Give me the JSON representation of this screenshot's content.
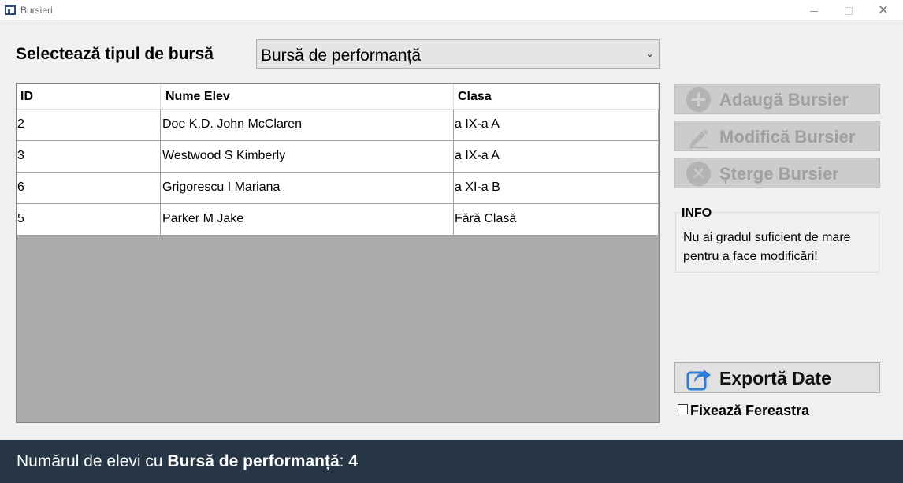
{
  "window": {
    "title": "Bursieri"
  },
  "selector": {
    "label": "Selectează tipul de bursă",
    "selected": "Bursă de performanță"
  },
  "table": {
    "columns": [
      "ID",
      "Nume Elev",
      "Clasa"
    ],
    "rows": [
      {
        "id": "2",
        "name": "Doe K.D. John McClaren",
        "class": "a IX-a A"
      },
      {
        "id": "3",
        "name": "Westwood S Kimberly",
        "class": "a IX-a A"
      },
      {
        "id": "6",
        "name": "Grigorescu I Mariana",
        "class": "a XI-a B"
      },
      {
        "id": "5",
        "name": "Parker M Jake",
        "class": "Fără Clasă"
      }
    ]
  },
  "actions": {
    "add_label": "Adaugă Bursier",
    "edit_label": "Modifică Bursier",
    "delete_label": "Șterge Bursier",
    "disabled": true
  },
  "info": {
    "title": "INFO",
    "message": "Nu ai gradul suficient de mare pentru a face modificări!"
  },
  "export": {
    "label": "Exportă Date"
  },
  "pin_window": {
    "label": "Fixează Fereastra",
    "checked": false
  },
  "status": {
    "prefix": "Numărul de elevi cu ",
    "bursa": "Bursă de performanță",
    "separator": ": ",
    "count": "4"
  },
  "colors": {
    "statusbar": "#263646",
    "accent_icon": "#2d7dd2",
    "disabled_text": "#a0a0a0"
  },
  "icons": {
    "add": "plus-circle-icon",
    "edit": "pencil-icon",
    "delete": "x-circle-icon",
    "export": "share-arrow-icon"
  }
}
